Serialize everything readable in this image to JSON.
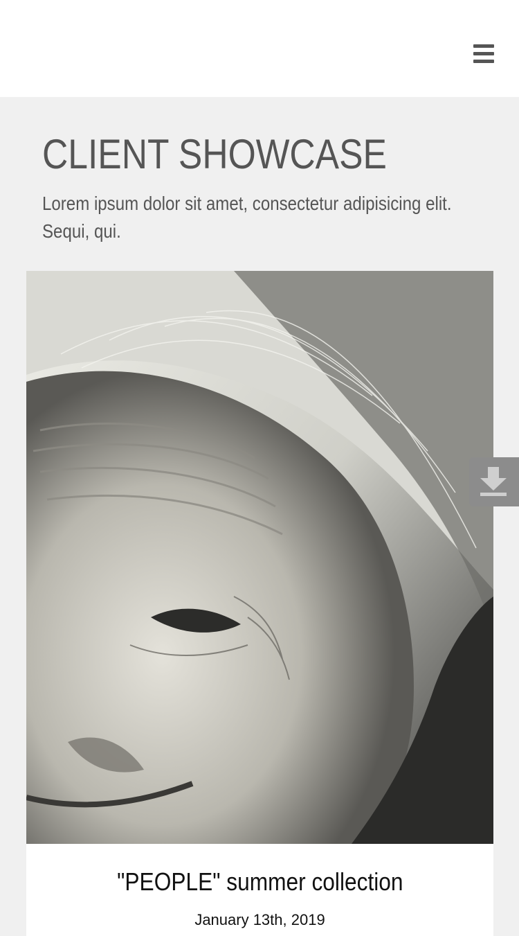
{
  "header": {
    "menu_icon": "hamburger-menu-icon"
  },
  "hero": {
    "title": "CLIENT SHOWCASE",
    "subtitle": "Lorem ipsum dolor sit amet, consectetur adipisicing elit. Sequi, qui."
  },
  "card": {
    "image_alt": "Portrait of an elderly woman",
    "title": "\"PEOPLE\" summer collection",
    "date": "January 13th, 2019"
  },
  "download": {
    "icon": "download-icon"
  },
  "colors": {
    "page_bg": "#f0f0f0",
    "header_bg": "#ffffff",
    "text_gray": "#555555",
    "download_bg": "#8c8c8c"
  }
}
